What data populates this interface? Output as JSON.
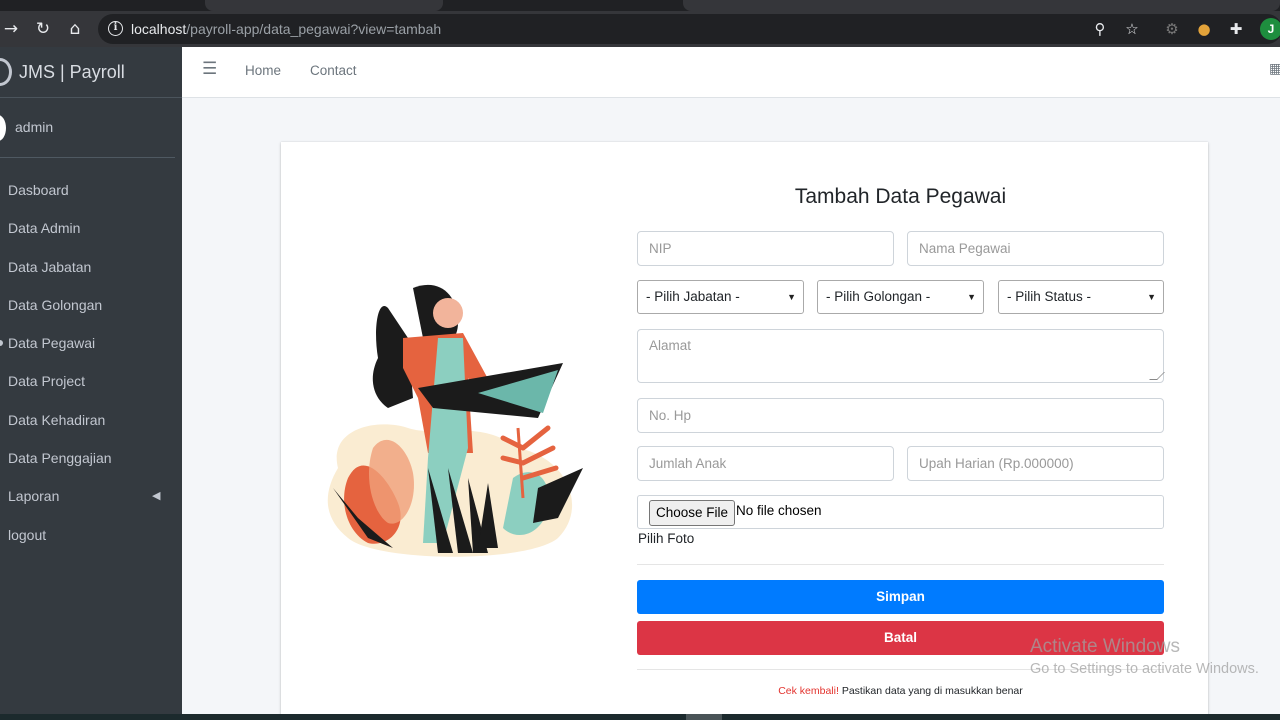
{
  "browser": {
    "url_host": "localhost",
    "url_path": "/payroll-app/data_pegawai?view=tambah",
    "profile_initial": "J"
  },
  "sidebar": {
    "brand": "JMS | Payroll",
    "user": "admin",
    "items": [
      {
        "label": "Dasboard"
      },
      {
        "label": "Data Admin"
      },
      {
        "label": "Data Jabatan"
      },
      {
        "label": "Data Golongan"
      },
      {
        "label": "Data Pegawai"
      },
      {
        "label": "Data Project"
      },
      {
        "label": "Data Kehadiran"
      },
      {
        "label": "Data Penggajian"
      },
      {
        "label": "Laporan"
      },
      {
        "label": "logout"
      }
    ]
  },
  "topnav": {
    "home": "Home",
    "contact": "Contact"
  },
  "form": {
    "title": "Tambah Data Pegawai",
    "nip_placeholder": "NIP",
    "nama_placeholder": "Nama Pegawai",
    "jabatan_select": "- Pilih Jabatan -",
    "golongan_select": "- Pilih Golongan -",
    "status_select": "- Pilih Status -",
    "alamat_placeholder": "Alamat",
    "hp_placeholder": "No. Hp",
    "anak_placeholder": "Jumlah Anak",
    "upah_placeholder": "Upah Harian (Rp.000000)",
    "file_button": "Choose File",
    "file_status": "No file chosen",
    "file_help": "Pilih Foto",
    "save_button": "Simpan",
    "cancel_button": "Batal",
    "note_warning": "Cek kembali!",
    "note_text": " Pastikan data yang di masukkan benar"
  },
  "watermark": {
    "line1": "Activate Windows",
    "line2": "Go to Settings to activate Windows."
  },
  "colors": {
    "primary": "#007bff",
    "danger": "#dc3545",
    "sidebar": "#343a40"
  }
}
